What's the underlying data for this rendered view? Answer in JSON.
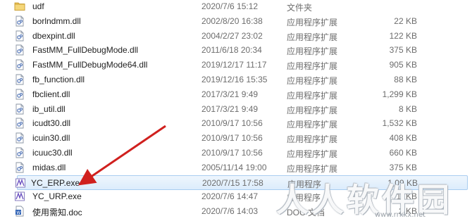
{
  "files": [
    {
      "name": "udf",
      "date": "2020/7/6 15:12",
      "type": "文件夹",
      "size": "",
      "icon": "folder-icon"
    },
    {
      "name": "borlndmm.dll",
      "date": "2002/8/20 16:38",
      "type": "应用程序扩展",
      "size": "22 KB",
      "icon": "dll-icon"
    },
    {
      "name": "dbexpint.dll",
      "date": "2004/2/27 23:02",
      "type": "应用程序扩展",
      "size": "122 KB",
      "icon": "dll-icon"
    },
    {
      "name": "FastMM_FullDebugMode.dll",
      "date": "2011/6/18 20:34",
      "type": "应用程序扩展",
      "size": "375 KB",
      "icon": "dll-icon"
    },
    {
      "name": "FastMM_FullDebugMode64.dll",
      "date": "2019/12/17 11:17",
      "type": "应用程序扩展",
      "size": "905 KB",
      "icon": "dll-icon"
    },
    {
      "name": "fb_function.dll",
      "date": "2019/12/16 15:35",
      "type": "应用程序扩展",
      "size": "88 KB",
      "icon": "dll-icon"
    },
    {
      "name": "fbclient.dll",
      "date": "2017/3/21 9:49",
      "type": "应用程序扩展",
      "size": "1,299 KB",
      "icon": "dll-icon"
    },
    {
      "name": "ib_util.dll",
      "date": "2017/3/21 9:49",
      "type": "应用程序扩展",
      "size": "8 KB",
      "icon": "dll-icon"
    },
    {
      "name": "icudt30.dll",
      "date": "2010/9/17 10:56",
      "type": "应用程序扩展",
      "size": "1,532 KB",
      "icon": "dll-icon"
    },
    {
      "name": "icuin30.dll",
      "date": "2010/9/17 10:56",
      "type": "应用程序扩展",
      "size": "408 KB",
      "icon": "dll-icon"
    },
    {
      "name": "icuuc30.dll",
      "date": "2010/9/17 10:56",
      "type": "应用程序扩展",
      "size": "660 KB",
      "icon": "dll-icon"
    },
    {
      "name": "midas.dll",
      "date": "2005/11/14 19:00",
      "type": "应用程序扩展",
      "size": "375 KB",
      "icon": "dll-icon"
    },
    {
      "name": "YC_ERP.exe",
      "date": "2020/7/15 17:58",
      "type": "应用程序",
      "size": "1,09  KB",
      "icon": "exe-icon",
      "selected": true
    },
    {
      "name": "YC_URP.exe",
      "date": "2020/7/6 14:47",
      "type": "应用程序",
      "size": "1,  KB",
      "icon": "exe-icon"
    },
    {
      "name": "使用需知.doc",
      "date": "2020/7/6 14:03",
      "type": "DOC 文档",
      "size": "2  KB",
      "icon": "doc-icon"
    }
  ],
  "watermark": {
    "text": "人人软件园",
    "url": "www.rrkkx.net"
  },
  "colors": {
    "selection_bg": "#dcecfc",
    "selection_border": "#a9cdf0",
    "arrow": "#d0201e",
    "secondary_text": "#6d6d6d"
  }
}
